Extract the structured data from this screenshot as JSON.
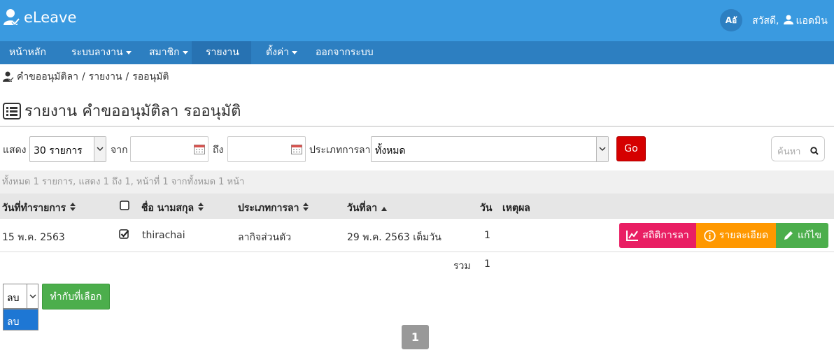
{
  "app": {
    "title": "eLeave"
  },
  "header": {
    "lang_label": "Aอั",
    "greeting": "สวัสดี,",
    "user_name": "แอดมิน"
  },
  "nav": {
    "home": "หน้าหลัก",
    "leave_system": "ระบบลางาน",
    "members": "สมาชิก",
    "reports": "รายงาน",
    "settings": "ตั้งค่า",
    "logout": "ออกจากระบบ"
  },
  "breadcrumb": {
    "item1": "คำขออนุมัติลา",
    "item2": "รายงาน",
    "item3": "รออนุมัติ",
    "separator": "/"
  },
  "page": {
    "title": "รายงาน คำขออนุมัติลา รออนุมัติ"
  },
  "filters": {
    "show_label": "แสดง",
    "show_value": "30 รายการ",
    "from_label": "จาก",
    "to_label": "ถึง",
    "type_label": "ประเภทการลา",
    "type_value": "ทั้งหมด",
    "go_label": "Go",
    "search_placeholder": "ค้นหา"
  },
  "summary": "ทั้งหมด 1 รายการ, แสดง 1 ถึง 1, หน้าที่ 1 จากทั้งหมด 1 หน้า",
  "table": {
    "headers": {
      "date": "วันที่ทำรายการ",
      "name": "ชื่อ นามสกุล",
      "type": "ประเภทการลา",
      "leave_date": "วันที่ลา",
      "days": "วัน",
      "reason": "เหตุผล"
    },
    "rows": [
      {
        "date": "15 พ.ค. 2563",
        "checked": true,
        "name": "thirachai",
        "type": "ลากิจส่วนตัว",
        "leave_date": "29 พ.ค. 2563 เต็มวัน",
        "days": "1",
        "reason": ""
      }
    ],
    "total_label": "รวม",
    "total_value": "1"
  },
  "row_buttons": {
    "stats": "สถิติการลา",
    "details": "รายละเอียด",
    "edit": "แก้ไข"
  },
  "bulk": {
    "action_value": "ลบ",
    "option_delete": "ลบ",
    "apply_label": "ทำกับที่เลือก"
  },
  "pagination": {
    "current": "1"
  },
  "colors": {
    "header_bg": "#3a9ae0",
    "nav_bg": "#2d7fc1",
    "go": "#d50000",
    "stats": "#e91e63",
    "details": "#ff9800",
    "edit": "#4cae4c"
  }
}
